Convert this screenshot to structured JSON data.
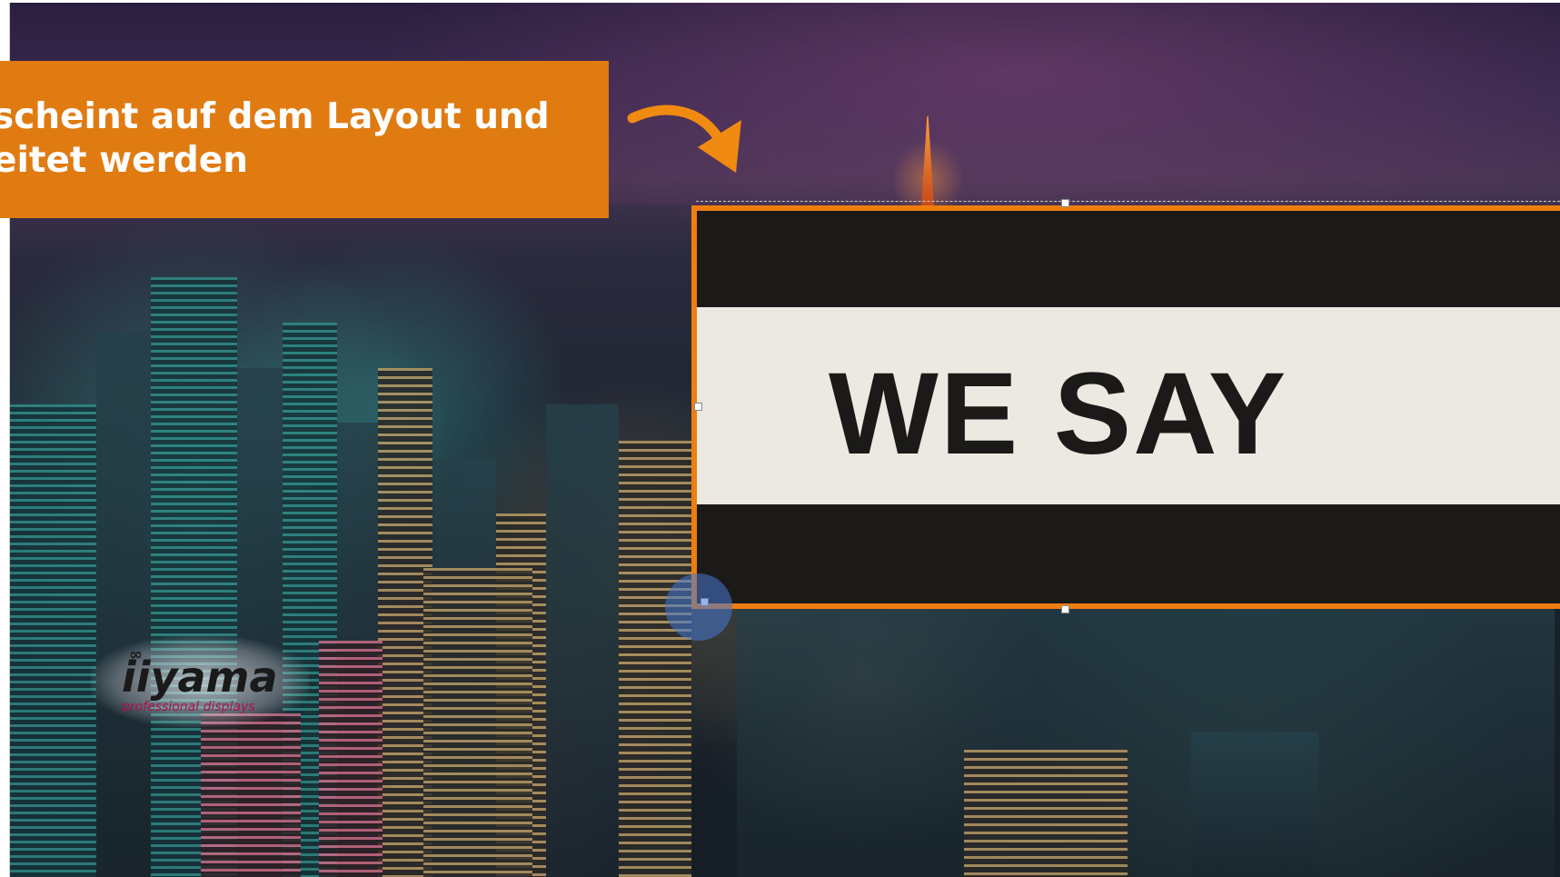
{
  "caption": {
    "line1": "scheint auf dem Layout und",
    "line2": "eitet werden"
  },
  "media_element": {
    "text": "WE SAY"
  },
  "logo": {
    "brand": "iiyama",
    "tagline": "professional displays"
  },
  "colors": {
    "accent_orange": "#e07b12",
    "selection_border": "#f07d10",
    "media_dark": "#1b1a19",
    "media_light": "#ece9e2",
    "cursor_highlight": "#4678d2",
    "logo_tagline": "#b0104a"
  },
  "icons": {
    "arrow": "curved-arrow-icon",
    "cursor": "cursor-click-indicator-icon"
  }
}
